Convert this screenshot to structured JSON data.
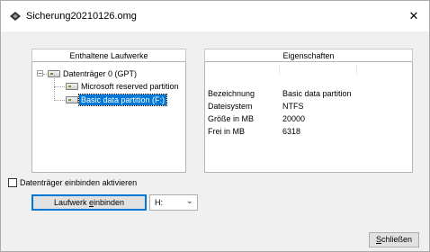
{
  "window": {
    "title": "Sicherung20210126.omg",
    "close_glyph": "✕"
  },
  "drives_panel": {
    "header": "Enthaltene Laufwerke",
    "tree": {
      "root": {
        "label": "Datenträger 0 (GPT)",
        "expander": "−",
        "icon": "disk-icon"
      },
      "children": [
        {
          "label": "Microsoft reserved partition",
          "selected": false,
          "icon": "partition-icon"
        },
        {
          "label": "Basic data partition (F:)",
          "selected": true,
          "icon": "partition-icon"
        }
      ]
    }
  },
  "properties_panel": {
    "header": "Eigenschaften",
    "rows": [
      {
        "label": "Bezeichnung",
        "value": "Basic data partition"
      },
      {
        "label": "Dateisystem",
        "value": "NTFS"
      },
      {
        "label": "Größe in MB",
        "value": "20000"
      },
      {
        "label": "Frei in MB",
        "value": "6318"
      }
    ]
  },
  "mount_checkbox": {
    "label": "Datenträger einbinden aktivieren",
    "checked": false
  },
  "mount_button": {
    "label_pre": "Laufwerk ",
    "label_accel": "e",
    "label_post": "inbinden"
  },
  "drive_letter_select": {
    "value": "H:",
    "chevron": "⌄"
  },
  "close_button": {
    "label_accel": "S",
    "label_post": "chließen"
  },
  "colors": {
    "selection": "#0078d7",
    "window_bg": "#f0f0f0"
  }
}
